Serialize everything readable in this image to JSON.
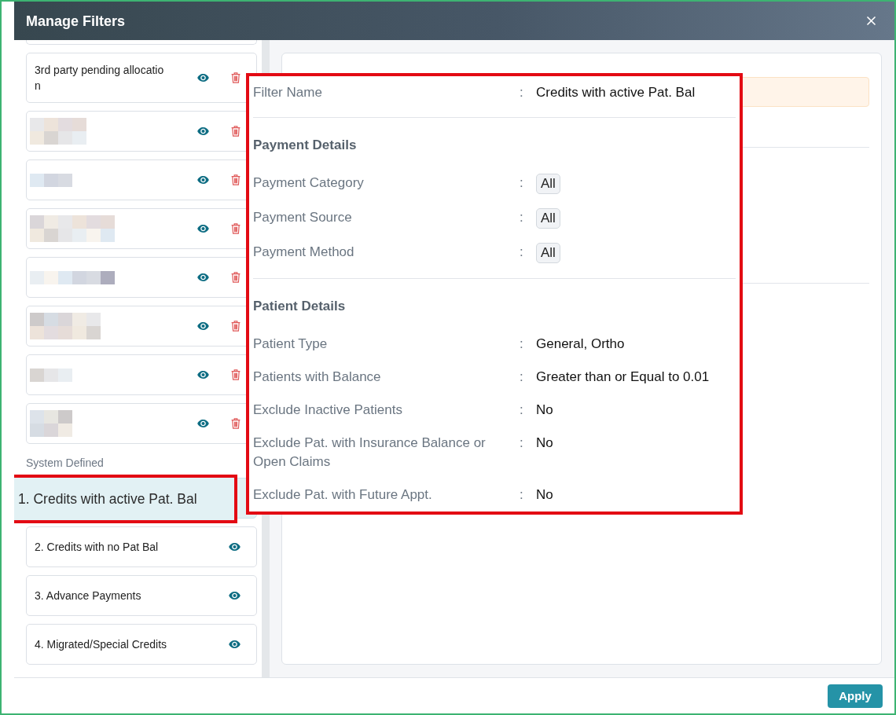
{
  "dialog": {
    "title": "Manage Filters"
  },
  "saved_filters": [
    {
      "kind": "named",
      "name": "3rd party pending allocation",
      "selected": false
    },
    {
      "kind": "blurred",
      "selected": false
    },
    {
      "kind": "blurred",
      "selected": false
    },
    {
      "kind": "blurred",
      "selected": false
    },
    {
      "kind": "blurred",
      "selected": false
    },
    {
      "kind": "blurred",
      "selected": false
    },
    {
      "kind": "blurred",
      "selected": false
    },
    {
      "kind": "blurred",
      "selected": false
    }
  ],
  "system_section": {
    "label": "System Defined"
  },
  "system_filters": [
    {
      "kind": "named",
      "name": "1. Credits with active Pat. Bal",
      "selected": true
    },
    {
      "kind": "named",
      "name": "2. Credits with no Pat Bal",
      "selected": false
    },
    {
      "kind": "named",
      "name": "3. Advance Payments",
      "selected": false
    },
    {
      "kind": "named",
      "name": "4. Migrated/Special Credits",
      "selected": false
    }
  ],
  "details": {
    "filter_name": {
      "label": "Filter Name",
      "separator": ":",
      "value": "Credits with active Pat. Bal"
    },
    "sections": [
      {
        "title": "Payment Details",
        "rows": [
          {
            "label": "Payment Category",
            "separator": ":",
            "value": "All",
            "kind": "chip"
          },
          {
            "label": "Payment Source",
            "separator": ":",
            "value": "All",
            "kind": "chip"
          },
          {
            "label": "Payment Method",
            "separator": ":",
            "value": "All",
            "kind": "chip"
          }
        ]
      },
      {
        "title": "Patient Details",
        "rows": [
          {
            "label": "Patient Type",
            "separator": ":",
            "value": "General, Ortho",
            "kind": "text"
          },
          {
            "label": "Patients with Balance",
            "separator": ":",
            "value": "Greater than or Equal to 0.01",
            "kind": "text"
          },
          {
            "label": "Exclude Inactive Patients",
            "separator": ":",
            "value": "No",
            "kind": "text"
          },
          {
            "label": "Exclude Pat. with Insurance Balance or Open Claims",
            "separator": ":",
            "value": "No",
            "kind": "text"
          },
          {
            "label": "Exclude Pat. with Future Appt.",
            "separator": ":",
            "value": "No",
            "kind": "text"
          }
        ]
      }
    ]
  },
  "footer": {
    "apply_button": "Apply"
  }
}
